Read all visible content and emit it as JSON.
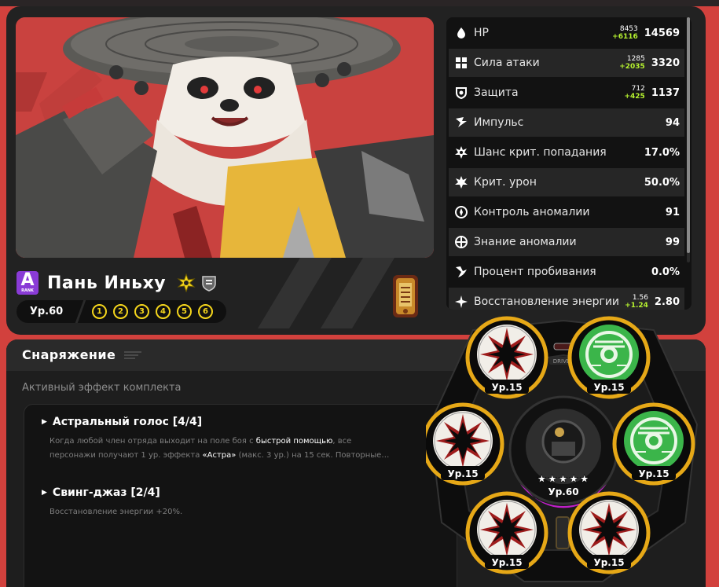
{
  "character": {
    "rank": "A",
    "rank_label": "RANK",
    "name": "Пань Иньху",
    "level": "Ур.60",
    "mindscapes": [
      "1",
      "2",
      "3",
      "4",
      "5",
      "6"
    ],
    "attribute_icon": "physical-attribute-icon",
    "faction_icon": "faction-shield-icon",
    "wengine_icon": "w-engine-icon"
  },
  "stats": [
    {
      "icon": "hp-icon",
      "label": "HP",
      "base": "8453",
      "bonus": "+6116",
      "value": "14569"
    },
    {
      "icon": "attack-icon",
      "label": "Сила атаки",
      "base": "1285",
      "bonus": "+2035",
      "value": "3320"
    },
    {
      "icon": "defense-icon",
      "label": "Защита",
      "base": "712",
      "bonus": "+425",
      "value": "1137"
    },
    {
      "icon": "impact-icon",
      "label": "Импульс",
      "base": "",
      "bonus": "",
      "value": "94"
    },
    {
      "icon": "crit-rate-icon",
      "label": "Шанс крит. попадания",
      "base": "",
      "bonus": "",
      "value": "17.0%"
    },
    {
      "icon": "crit-dmg-icon",
      "label": "Крит. урон",
      "base": "",
      "bonus": "",
      "value": "50.0%"
    },
    {
      "icon": "anomaly-mastery-icon",
      "label": "Контроль аномалии",
      "base": "",
      "bonus": "",
      "value": "91"
    },
    {
      "icon": "anomaly-proficiency-icon",
      "label": "Знание аномалии",
      "base": "",
      "bonus": "",
      "value": "99"
    },
    {
      "icon": "pen-ratio-icon",
      "label": "Процент пробивания",
      "base": "",
      "bonus": "",
      "value": "0.0%"
    },
    {
      "icon": "energy-regen-icon",
      "label": "Восстановление энергии",
      "base": "1.56",
      "bonus": "+1.24",
      "value": "2.80"
    }
  ],
  "equipment": {
    "title": "Снаряжение",
    "active_label": "Активный эффект комплекта",
    "sets": [
      {
        "name": "Астральный голос [4/4]",
        "desc_parts": [
          "Когда любой член отряда выходит на поле боя с ",
          "быстрой помощью",
          ", все персонажи получают 1 ур. эффекта ",
          "«Астра»",
          " (макс. 3 ур.) на 15 сек. Повторные…"
        ]
      },
      {
        "name": "Свинг-джаз [2/4]",
        "desc_parts": [
          "Восстановление энергии +20%."
        ]
      }
    ],
    "driver_label": "DRIVER",
    "center_level": "Ур.60",
    "center_stars": "★★★★★",
    "discs": [
      {
        "slot": "1",
        "type": "astral",
        "level": "Ур.15"
      },
      {
        "slot": "2",
        "type": "swing",
        "level": "Ур.15"
      },
      {
        "slot": "3",
        "type": "astral",
        "level": "Ур.15"
      },
      {
        "slot": "4",
        "type": "swing",
        "level": "Ур.15"
      },
      {
        "slot": "5",
        "type": "astral",
        "level": "Ур.15"
      },
      {
        "slot": "6",
        "type": "astral",
        "level": "Ур.15"
      }
    ]
  },
  "colors": {
    "accent": "#f4d51c",
    "bonus": "#b6f230",
    "rank": "#8a3bd6",
    "bg": "#d2413d",
    "swing": "#3bb54a"
  }
}
